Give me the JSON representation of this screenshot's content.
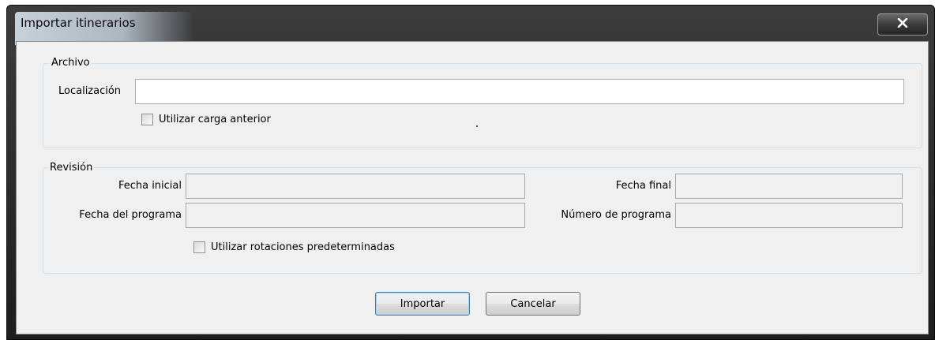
{
  "window": {
    "title": "Importar itinerarios",
    "close_icon": "close-icon"
  },
  "archivo": {
    "legend": "Archivo",
    "localizacion_label": "Localización",
    "localizacion_value": "",
    "carga_anterior_label": "Utilizar carga anterior",
    "carga_anterior_checked": false
  },
  "revision": {
    "legend": "Revisión",
    "fecha_inicial_label": "Fecha inicial",
    "fecha_inicial_value": "",
    "fecha_final_label": "Fecha final",
    "fecha_final_value": "",
    "fecha_programa_label": "Fecha del programa",
    "fecha_programa_value": "",
    "numero_programa_label": "Número de programa",
    "numero_programa_value": "",
    "rotaciones_label": "Utilizar rotaciones predeterminadas",
    "rotaciones_checked": false
  },
  "buttons": {
    "importar": "Importar",
    "cancelar": "Cancelar"
  },
  "colors": {
    "titlebar": "#1d1d1d",
    "client_bg": "#f0f0f0",
    "default_button_border": "#3c7fb1"
  }
}
